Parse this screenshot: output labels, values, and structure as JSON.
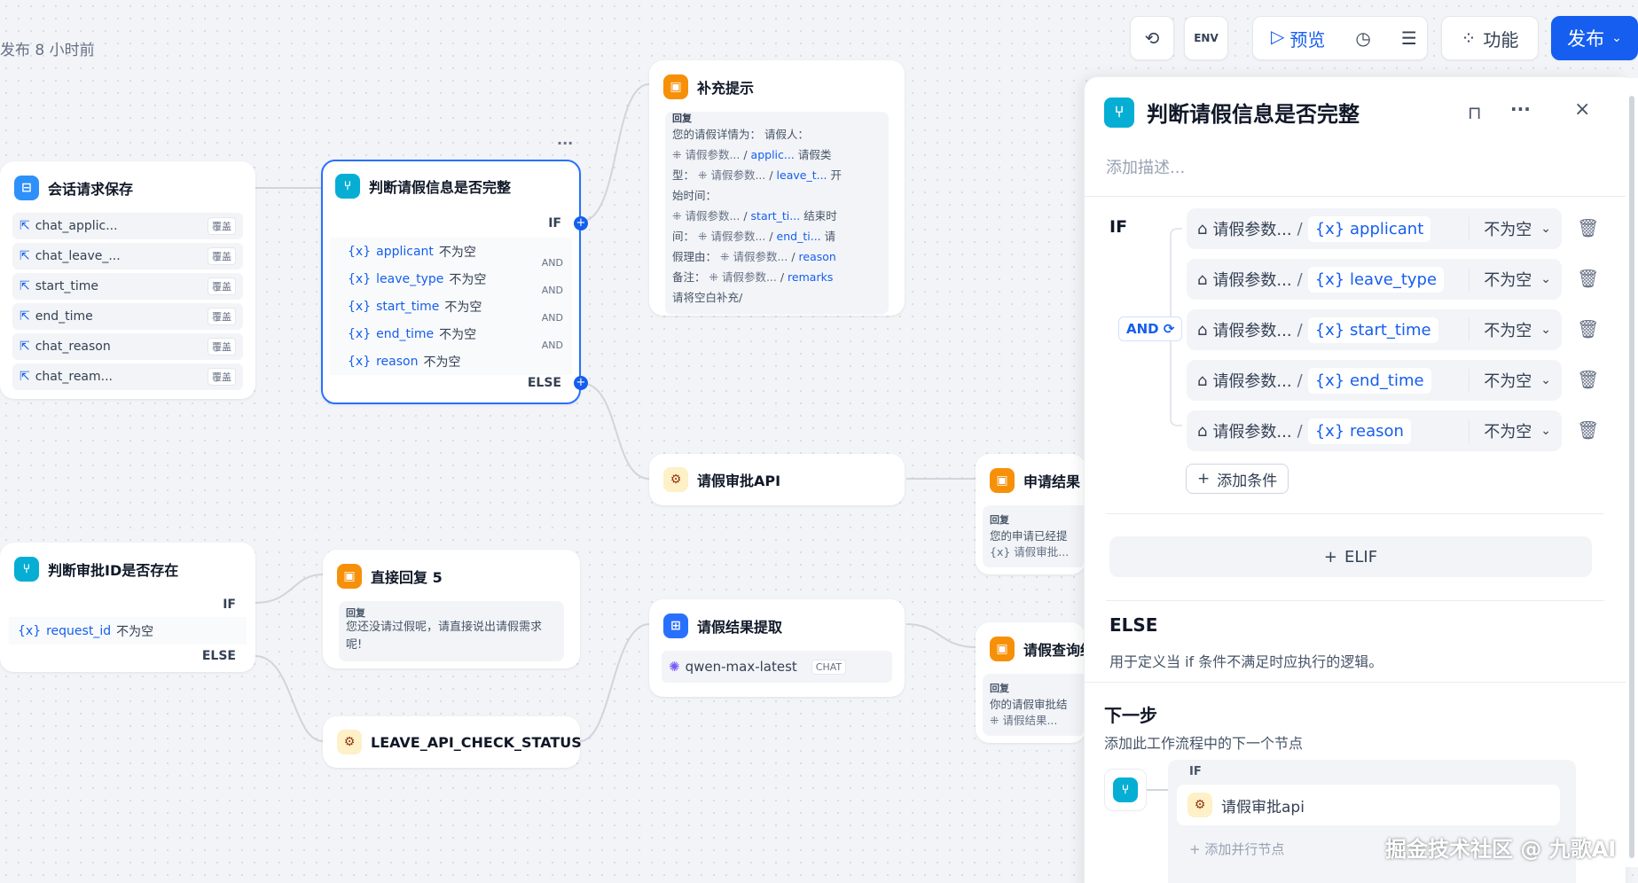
{
  "publish_time": "发布 8 小时前",
  "toolbar": {
    "env": "ENV",
    "preview": "预览",
    "features": "功能",
    "publish": "发布"
  },
  "nodes": {
    "session_save": {
      "title": "会话请求保存",
      "items": [
        "chat_applic...",
        "chat_leave_...",
        "start_time",
        "end_time",
        "chat_reason",
        "chat_ream..."
      ],
      "badge": "覆盖"
    },
    "judge_info": {
      "title": "判断请假信息是否完整",
      "if": "IF",
      "else": "ELSE",
      "and": "AND",
      "conds": [
        {
          "var": "applicant",
          "op": "不为空"
        },
        {
          "var": "leave_type",
          "op": "不为空"
        },
        {
          "var": "start_time",
          "op": "不为空"
        },
        {
          "var": "end_time",
          "op": "不为空"
        },
        {
          "var": "reason",
          "op": "不为空"
        }
      ]
    },
    "supplement": {
      "title": "补充提示",
      "reply_label": "回复",
      "t1": "您的请假详情为：  请假人：",
      "c1": "请假参数...",
      "v1": "applic...",
      "t2": "请假类",
      "t3": "型：",
      "c2": "请假参数...",
      "v2": "leave_t...",
      "t4": "开",
      "t5": "始时间：",
      "c3": "请假参数...",
      "v3": "start_ti...",
      "t6": "结束时",
      "t7": "间：",
      "c4": "请假参数...",
      "v4": "end_ti...",
      "t8": "请",
      "t9": "假理由：",
      "c5": "请假参数...",
      "v5": "reason",
      "t10": "备注：",
      "c6": "请假参数...",
      "v6": "remarks",
      "t11": "请将空白补充/"
    },
    "leave_api": {
      "title": "请假审批API"
    },
    "apply_result": {
      "title": "申请结果",
      "reply_label": "回复",
      "text": "您的申请已经提",
      "chip": "请假审批..."
    },
    "judge_id": {
      "title": "判断审批ID是否存在",
      "if": "IF",
      "else": "ELSE",
      "cond_var": "request_id",
      "cond_op": "不为空"
    },
    "direct_reply": {
      "title": "直接回复 5",
      "reply_label": "回复",
      "text": "您还没请过假呢，请直接说出请假需求呢!"
    },
    "result_extract": {
      "title": "请假结果提取",
      "model": "qwen-max-latest",
      "model_tag": "CHAT"
    },
    "check_status": {
      "title": "LEAVE_API_CHECK_STATUS"
    },
    "query_result": {
      "title": "请假查询结",
      "reply_label": "回复",
      "text": "你的请假审批结",
      "chip": "请假结果..."
    }
  },
  "panel": {
    "title": "判断请假信息是否完整",
    "desc_placeholder": "添加描述...",
    "if_label": "IF",
    "logic": "AND",
    "conditions": [
      {
        "src": "请假参数...",
        "var": "applicant",
        "op": "不为空"
      },
      {
        "src": "请假参数...",
        "var": "leave_type",
        "op": "不为空"
      },
      {
        "src": "请假参数...",
        "var": "start_time",
        "op": "不为空"
      },
      {
        "src": "请假参数...",
        "var": "end_time",
        "op": "不为空"
      },
      {
        "src": "请假参数...",
        "var": "reason",
        "op": "不为空"
      }
    ],
    "add_condition": "添加条件",
    "elif": "ELIF",
    "else_title": "ELSE",
    "else_desc": "用于定义当 if 条件不满足时应执行的逻辑。",
    "next_title": "下一步",
    "next_desc": "添加此工作流程中的下一个节点",
    "next_if": "IF",
    "next_node": "请假审批api",
    "add_parallel": "添加并行节点"
  },
  "watermark": "掘金技术社区 @ 九歌AI",
  "colors": {
    "accent": "#155eef",
    "canvas": "#f2f4f7",
    "edge": "#d0d5dd"
  }
}
